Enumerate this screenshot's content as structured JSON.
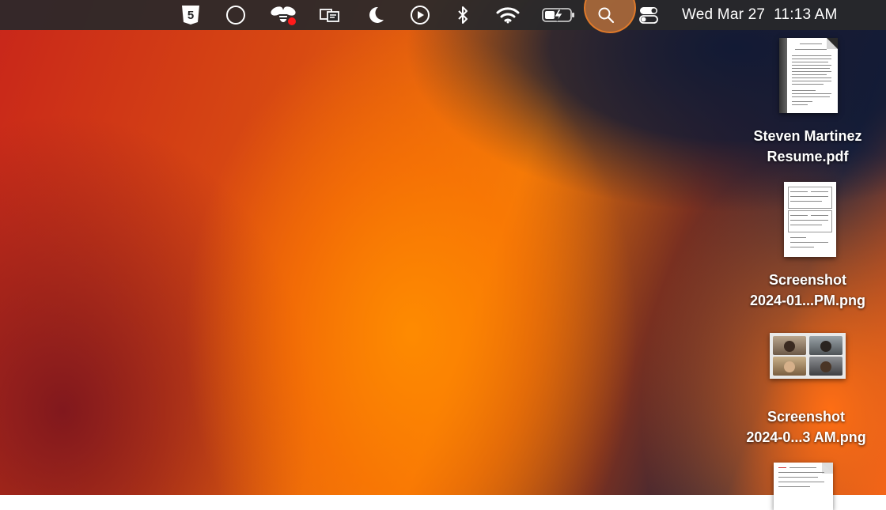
{
  "menubar": {
    "icons": [
      {
        "name": "html5-app-icon"
      },
      {
        "name": "circle-app-icon"
      },
      {
        "name": "bee-app-icon"
      },
      {
        "name": "screen-mirroring-icon"
      },
      {
        "name": "do-not-disturb-moon-icon"
      },
      {
        "name": "media-play-icon"
      },
      {
        "name": "bluetooth-icon"
      },
      {
        "name": "wifi-icon"
      },
      {
        "name": "battery-charging-icon"
      },
      {
        "name": "spotlight-search-icon"
      },
      {
        "name": "control-center-icon"
      }
    ],
    "clock": "Wed Mar 27  11:13 AM",
    "colors": {
      "bar": "#28282a",
      "spotlight_highlight": "#b46e3c",
      "notification_dot": "#ff1a1a"
    }
  },
  "desktop": {
    "items": [
      {
        "name_line1": "Steven Martinez",
        "name_line2": "Resume.pdf",
        "icon": "pdf-document-thumbnail"
      },
      {
        "name_line1": "Screenshot",
        "name_line2": "2024-01...PM.png",
        "icon": "document-screenshot-thumbnail"
      },
      {
        "name_line1": "Screenshot",
        "name_line2": "2024-0...3 AM.png",
        "icon": "video-call-screenshot-thumbnail"
      },
      {
        "icon": "document-screenshot-thumbnail"
      }
    ]
  }
}
